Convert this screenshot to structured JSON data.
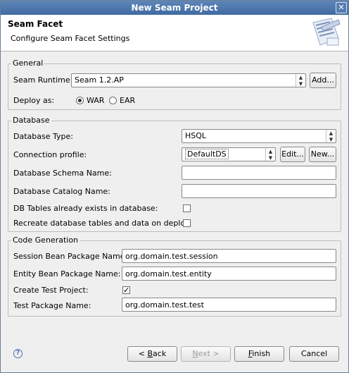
{
  "window": {
    "title": "New Seam Project"
  },
  "banner": {
    "title": "Seam Facet",
    "description": "Configure Seam Facet Settings",
    "icon": "wizard-icon"
  },
  "general": {
    "title": "General",
    "runtime_label": "Seam Runtime:",
    "runtime_value": "Seam 1.2.AP",
    "add_label": "Add...",
    "deploy_label": "Deploy as:",
    "deploy_options": [
      "WAR",
      "EAR"
    ],
    "deploy_selected": "WAR"
  },
  "database": {
    "title": "Database",
    "type_label": "Database Type:",
    "type_value": "HSQL",
    "profile_label": "Connection profile:",
    "profile_value": "DefaultDS",
    "edit_label": "Edit...",
    "new_label": "New...",
    "schema_label": "Database Schema Name:",
    "schema_value": "",
    "catalog_label": "Database Catalog Name:",
    "catalog_value": "",
    "tables_exist_label": "DB Tables already exists in database:",
    "tables_exist_checked": false,
    "recreate_label": "Recreate database tables and data on deploy:",
    "recreate_checked": false
  },
  "codegen": {
    "title": "Code Generation",
    "session_label": "Session Bean Package Name:",
    "session_value": "org.domain.test.session",
    "entity_label": "Entity Bean Package Name:",
    "entity_value": "org.domain.test.entity",
    "create_test_label": "Create Test Project:",
    "create_test_checked": true,
    "test_pkg_label": "Test Package Name:",
    "test_pkg_value": "org.domain.test.test"
  },
  "buttons": {
    "back_prefix": "< ",
    "back_mnemonic": "B",
    "back_rest": "ack",
    "next_prefix": "",
    "next_mnemonic": "N",
    "next_rest": "ext >",
    "finish_prefix": "",
    "finish_mnemonic": "F",
    "finish_rest": "inish",
    "cancel_label": "Cancel"
  },
  "icons": {
    "close": "close-icon",
    "help": "help-icon"
  }
}
